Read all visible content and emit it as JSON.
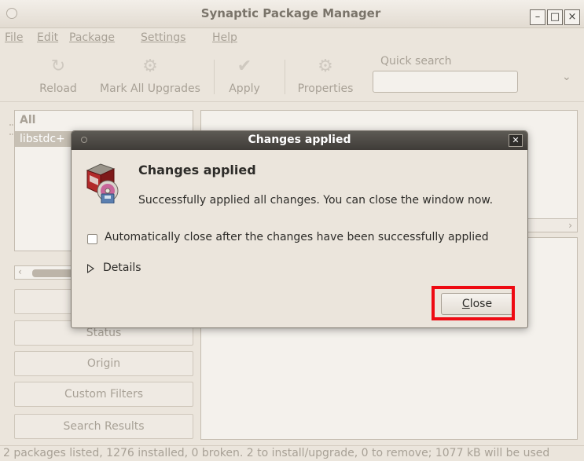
{
  "window": {
    "title": "Synaptic Package Manager"
  },
  "menus": [
    "File",
    "Edit",
    "Package",
    "Settings",
    "Help"
  ],
  "toolbar": {
    "reload": "Reload",
    "mark_all_upgrades": "Mark All Upgrades",
    "apply": "Apply",
    "properties": "Properties",
    "quick_search_label": "Quick search",
    "quick_search_value": ""
  },
  "filters": {
    "header": "All",
    "selected": "libstdc+"
  },
  "side_buttons": {
    "sections": "",
    "status": "Status",
    "origin": "Origin",
    "custom_filters": "Custom Filters",
    "search_results": "Search Results"
  },
  "status_bar": "2 packages listed, 1276 installed, 0 broken. 2 to install/upgrade, 0 to remove; 1077 kB will be used",
  "dialog": {
    "title": "Changes applied",
    "heading": "Changes applied",
    "message": "Successfully applied all changes. You can close the window now.",
    "auto_close_label": "Automatically close after the changes have been successfully applied",
    "auto_close_checked": false,
    "details_label": "Details",
    "close_button": "Close",
    "close_button_accel": "C",
    "close_button_rest": "lose"
  },
  "colors": {
    "highlight": "#ee0a12",
    "window_bg": "#ebe5dc",
    "dialog_title_bg": "#45423e"
  }
}
